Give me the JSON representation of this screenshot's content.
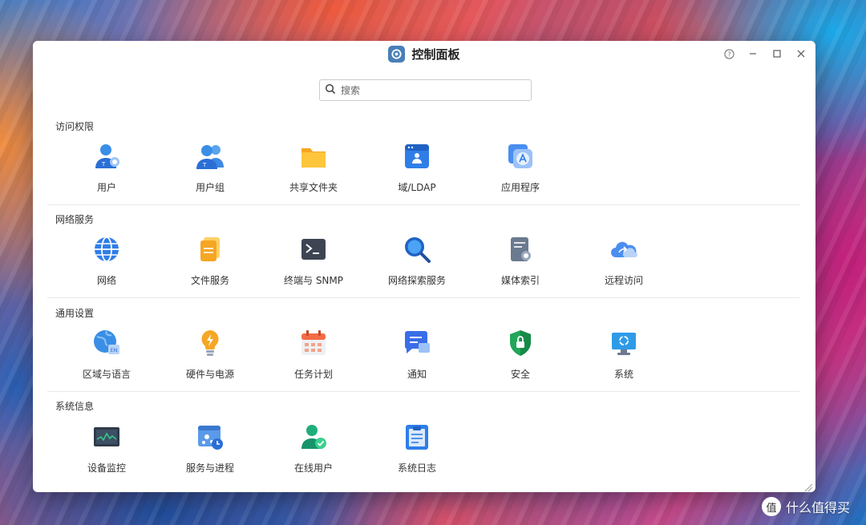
{
  "window": {
    "title": "控制面板",
    "controls": {
      "help": "?",
      "minimize": "–",
      "maximize": "□",
      "close": "✕"
    }
  },
  "search": {
    "placeholder": "搜索",
    "value": ""
  },
  "sections": [
    {
      "title": "访问权限",
      "items": [
        {
          "label": "用户",
          "icon": "user-icon"
        },
        {
          "label": "用户组",
          "icon": "user-group-icon"
        },
        {
          "label": "共享文件夹",
          "icon": "shared-folder-icon"
        },
        {
          "label": "域/LDAP",
          "icon": "domain-ldap-icon"
        },
        {
          "label": "应用程序",
          "icon": "application-icon"
        }
      ]
    },
    {
      "title": "网络服务",
      "items": [
        {
          "label": "网络",
          "icon": "network-globe-icon"
        },
        {
          "label": "文件服务",
          "icon": "file-service-icon"
        },
        {
          "label": "终端与 SNMP",
          "icon": "terminal-icon"
        },
        {
          "label": "网络探索服务",
          "icon": "network-discovery-icon"
        },
        {
          "label": "媒体索引",
          "icon": "media-index-icon"
        },
        {
          "label": "远程访问",
          "icon": "remote-access-cloud-icon"
        }
      ]
    },
    {
      "title": "通用设置",
      "items": [
        {
          "label": "区域与语言",
          "icon": "region-language-icon"
        },
        {
          "label": "硬件与电源",
          "icon": "hardware-power-icon"
        },
        {
          "label": "任务计划",
          "icon": "task-schedule-icon"
        },
        {
          "label": "通知",
          "icon": "notification-icon"
        },
        {
          "label": "安全",
          "icon": "security-shield-icon"
        },
        {
          "label": "系统",
          "icon": "system-monitor-icon"
        }
      ]
    },
    {
      "title": "系统信息",
      "items": [
        {
          "label": "设备监控",
          "icon": "device-monitor-icon"
        },
        {
          "label": "服务与进程",
          "icon": "services-processes-icon"
        },
        {
          "label": "在线用户",
          "icon": "online-users-icon"
        },
        {
          "label": "系统日志",
          "icon": "system-log-icon"
        }
      ]
    }
  ],
  "watermark": {
    "badge": "值",
    "text": "什么值得买"
  }
}
